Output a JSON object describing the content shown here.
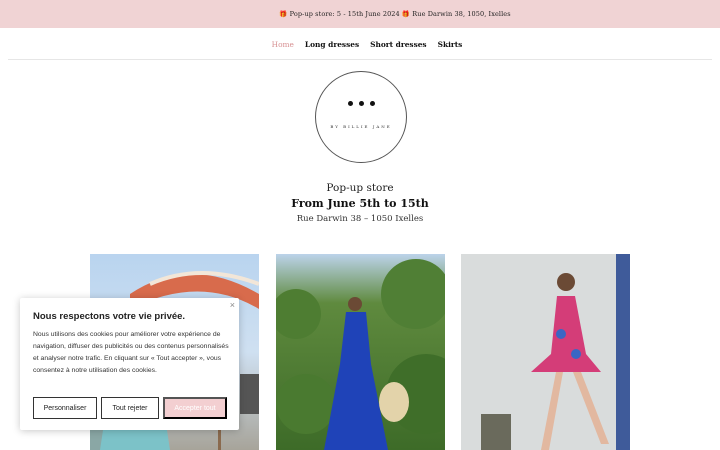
{
  "announcement": {
    "text": "🎁 Pop-up store: 5 - 15th June 2024 🎁 Rue Darwin 38, 1050, Ixelles"
  },
  "nav": {
    "items": [
      {
        "label": "Home",
        "active": true
      },
      {
        "label": "Long dresses",
        "active": false
      },
      {
        "label": "Short dresses",
        "active": false
      },
      {
        "label": "Skirts",
        "active": false
      }
    ]
  },
  "logo": {
    "text": "BY BILLIE JANE"
  },
  "popup": {
    "title": "Pop-up store",
    "dates": "From June 5th to 15th",
    "address": "Rue Darwin 38 – 1050 Ixelles"
  },
  "photos": [
    {
      "icon": "parasol-photo"
    },
    {
      "icon": "blue-dress-photo"
    },
    {
      "icon": "pink-dress-photo"
    }
  ],
  "cookie": {
    "close_icon": "×",
    "title": "Nous respectons votre vie privée.",
    "body": "Nous utilisons des cookies pour améliorer votre expérience de navigation, diffuser des publicités ou des contenus personnalisés et analyser notre trafic. En cliquant sur « Tout accepter », vous consentez à notre utilisation des cookies.",
    "customize_label": "Personnaliser",
    "reject_label": "Tout rejeter",
    "accept_label": "Accepter tout"
  },
  "colors": {
    "announce_bg": "#f0d3d4",
    "nav_active": "#d79193",
    "accept_bg": "#f3cfd1"
  }
}
